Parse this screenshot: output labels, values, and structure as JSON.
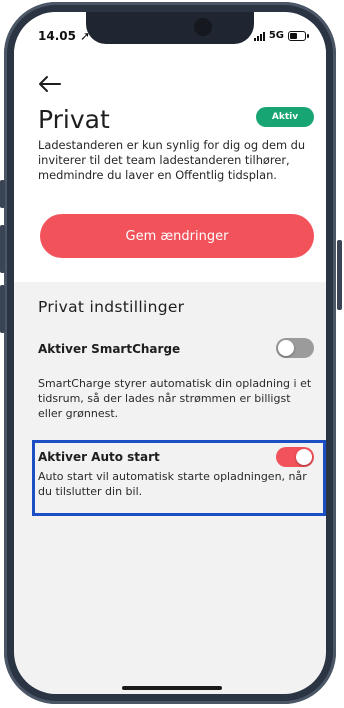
{
  "status_bar": {
    "time": "14.05",
    "network": "5G"
  },
  "header": {
    "title": "Privat",
    "badge": "Aktiv",
    "description": "Ladestanderen er kun synlig for dig og dem du inviterer til det team ladestanderen tilhører, medmindre du laver en Offentlig tidsplan.",
    "save_label": "Gem ændringer"
  },
  "settings": {
    "section_title": "Privat indstillinger",
    "smartcharge": {
      "label": "Aktiver SmartCharge",
      "enabled": false,
      "description": "SmartCharge styrer automatisk din opladning i et tidsrum, så der lades når strømmen er billigst eller grønnest."
    },
    "autostart": {
      "label": "Aktiver Auto start",
      "enabled": true,
      "description": "Auto start vil automatisk starte opladningen, når du tilslutter din bil."
    }
  },
  "colors": {
    "accent": "#f2525a",
    "badge": "#17a673",
    "highlight": "#1d4fc4"
  },
  "icons": {
    "back": "arrow-left-icon",
    "location": "location-arrow-icon",
    "signal": "signal-bars-icon",
    "battery": "battery-icon"
  }
}
